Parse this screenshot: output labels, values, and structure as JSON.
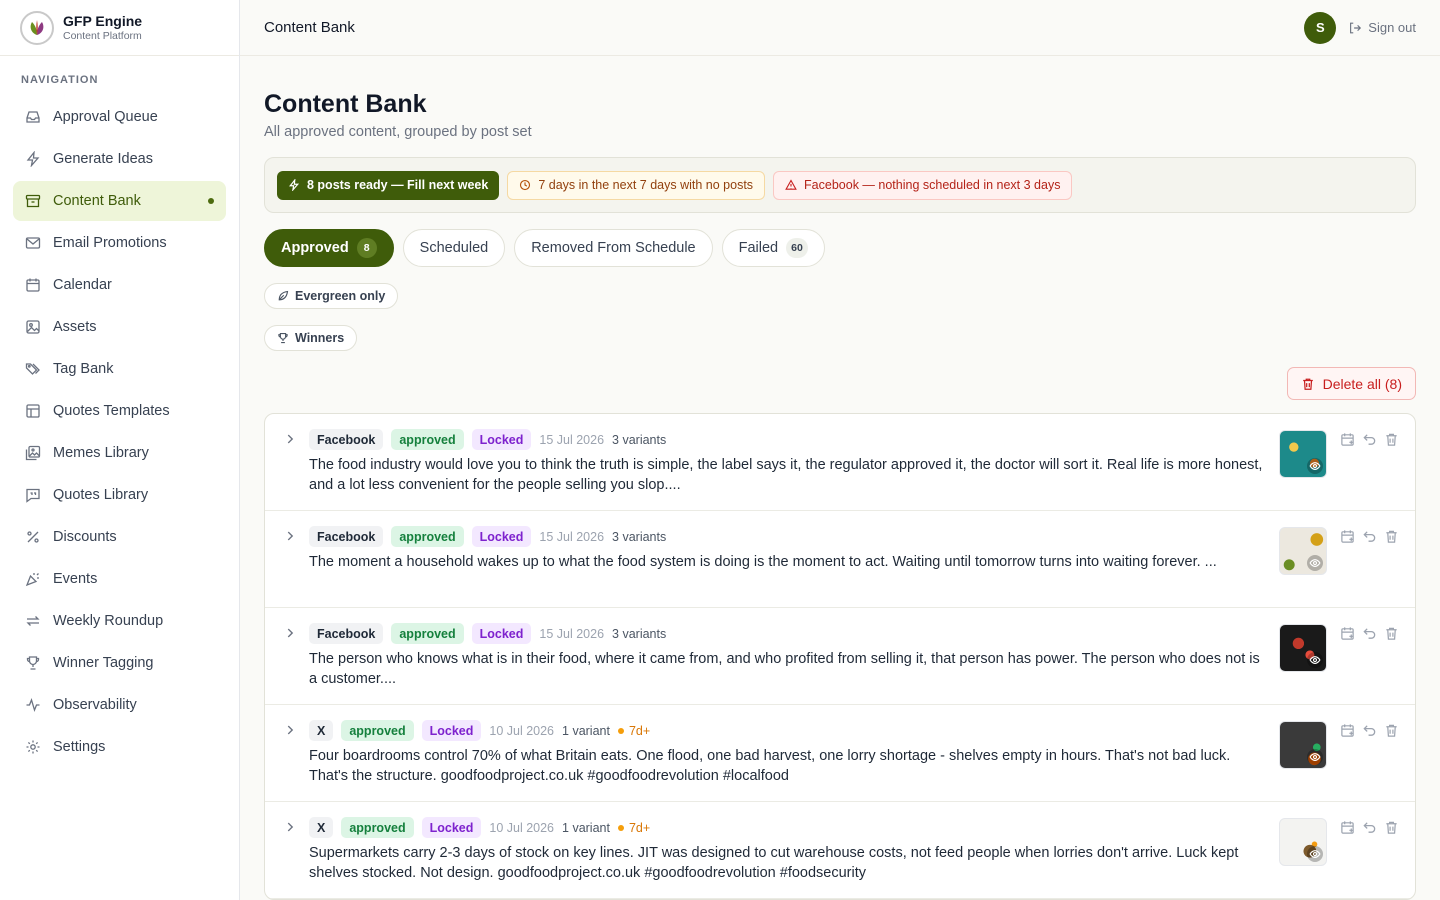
{
  "brand": {
    "title": "GFP Engine",
    "subtitle": "Content Platform"
  },
  "sidebar": {
    "heading": "NAVIGATION",
    "items": [
      {
        "label": "Approval Queue",
        "icon": "inbox-icon"
      },
      {
        "label": "Generate Ideas",
        "icon": "lightning-icon"
      },
      {
        "label": "Content Bank",
        "icon": "archive-icon",
        "active": true
      },
      {
        "label": "Email Promotions",
        "icon": "mail-icon"
      },
      {
        "label": "Calendar",
        "icon": "calendar-icon"
      },
      {
        "label": "Assets",
        "icon": "image-icon"
      },
      {
        "label": "Tag Bank",
        "icon": "tags-icon"
      },
      {
        "label": "Quotes Templates",
        "icon": "layout-icon"
      },
      {
        "label": "Memes Library",
        "icon": "images-icon"
      },
      {
        "label": "Quotes Library",
        "icon": "quote-icon"
      },
      {
        "label": "Discounts",
        "icon": "percent-icon"
      },
      {
        "label": "Events",
        "icon": "party-icon"
      },
      {
        "label": "Weekly Roundup",
        "icon": "repeat-icon"
      },
      {
        "label": "Winner Tagging",
        "icon": "trophy-icon"
      },
      {
        "label": "Observability",
        "icon": "activity-icon"
      },
      {
        "label": "Settings",
        "icon": "gear-icon"
      }
    ]
  },
  "header": {
    "title": "Content Bank",
    "avatar_initial": "S",
    "signout_label": "Sign out"
  },
  "main": {
    "title": "Content Bank",
    "subtitle": "All approved content, grouped by post set",
    "alerts": {
      "ready": "8 posts ready — Fill next week",
      "gap": "7 days in the next 7 days with no posts",
      "platform": "Facebook — nothing scheduled in next 3 days"
    },
    "tabs": [
      {
        "label": "Approved",
        "count": "8"
      },
      {
        "label": "Scheduled",
        "count": ""
      },
      {
        "label": "Removed From Schedule",
        "count": ""
      },
      {
        "label": "Failed",
        "count": "60"
      }
    ],
    "filters": {
      "evergreen": "Evergreen only",
      "winners": "Winners"
    },
    "delete_all_label": "Delete all (8)",
    "posts": [
      {
        "platform": "Facebook",
        "status": "approved",
        "lock": "Locked",
        "date": "15 Jul 2026",
        "variants": "3 variants",
        "age": "",
        "text": "The food industry would love you to think the truth is simple, the label says it, the regulator approved it, the doctor will sort it. Real life is more honest, and a lot less convenient for the people selling you slop...."
      },
      {
        "platform": "Facebook",
        "status": "approved",
        "lock": "Locked",
        "date": "15 Jul 2026",
        "variants": "3 variants",
        "age": "",
        "text": "The moment a household wakes up to what the food system is doing is the moment to act. Waiting until tomorrow turns into waiting forever. ..."
      },
      {
        "platform": "Facebook",
        "status": "approved",
        "lock": "Locked",
        "date": "15 Jul 2026",
        "variants": "3 variants",
        "age": "",
        "text": "The person who knows what is in their food, where it came from, and who profited from selling it, that person has power. The person who does not is a customer...."
      },
      {
        "platform": "X",
        "status": "approved",
        "lock": "Locked",
        "date": "10 Jul 2026",
        "variants": "1 variant",
        "age": "7d+",
        "text": "Four boardrooms control 70% of what Britain eats. One flood, one bad harvest, one lorry shortage - shelves empty in hours. That's not bad luck. That's the structure. goodfoodproject.co.uk #goodfoodrevolution #localfood"
      },
      {
        "platform": "X",
        "status": "approved",
        "lock": "Locked",
        "date": "10 Jul 2026",
        "variants": "1 variant",
        "age": "7d+",
        "text": "Supermarkets carry 2-3 days of stock on key lines. JIT was designed to cut warehouse costs, not feed people when lorries don't arrive. Luck kept shelves stocked. Not design. goodfoodproject.co.uk #goodfoodrevolution #foodsecurity"
      }
    ]
  },
  "colors": {
    "brand_green": "#3f5c0a",
    "active_nav_bg": "#eef5d9",
    "approved": "#15803d",
    "locked": "#7e22ce",
    "danger": "#c81e1e",
    "warn": "#92400e"
  }
}
